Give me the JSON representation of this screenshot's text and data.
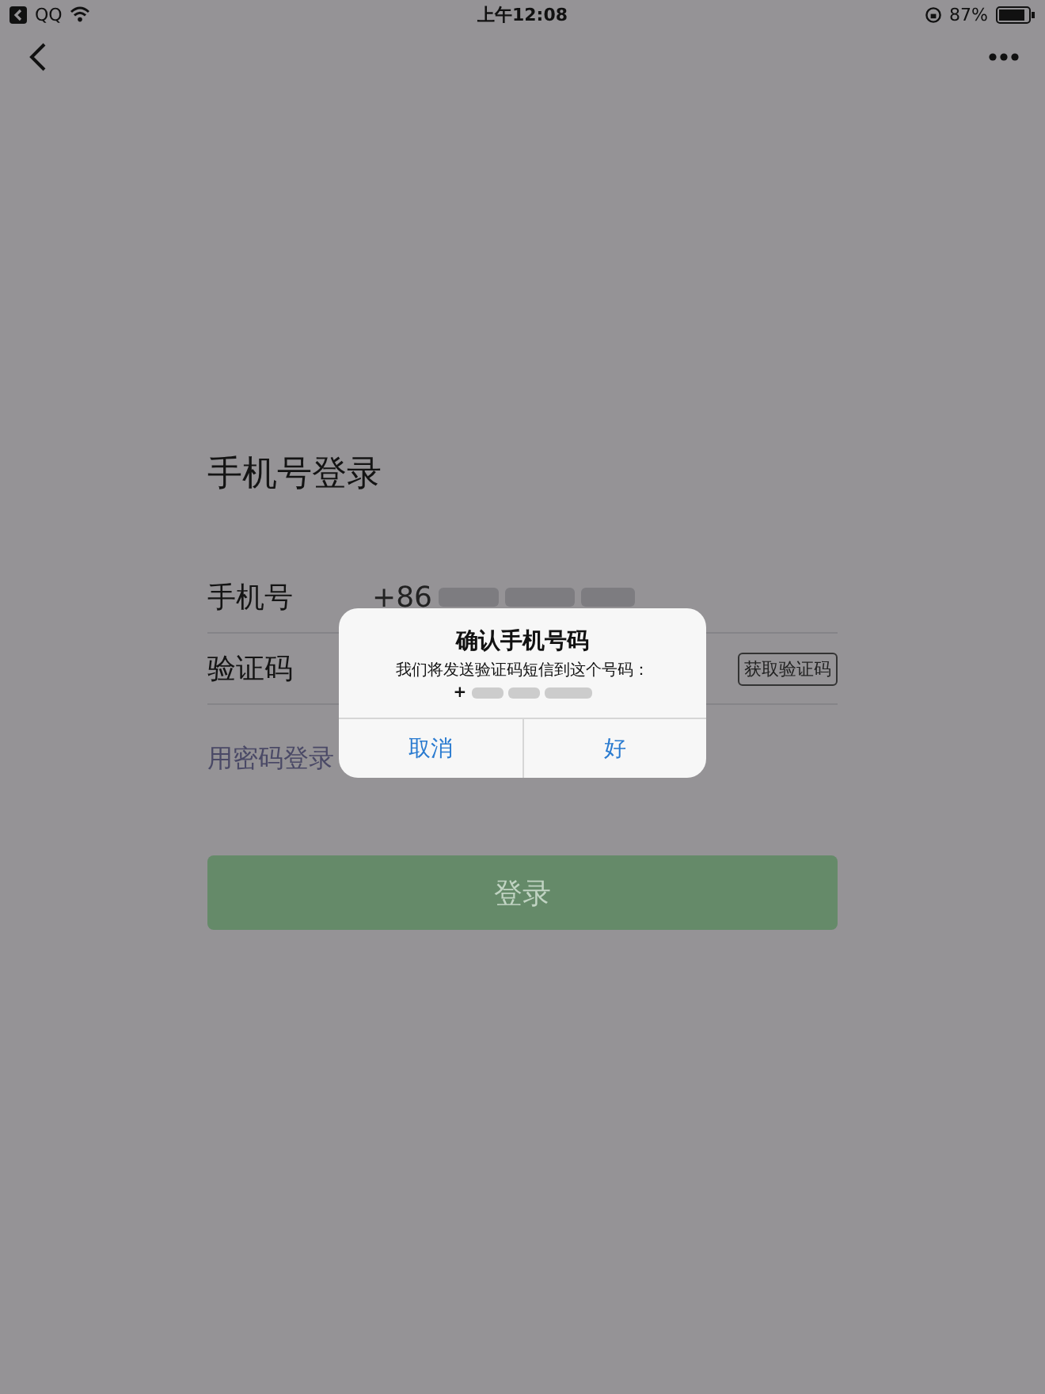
{
  "status_bar": {
    "back_app": "QQ",
    "time": "上午12:08",
    "battery": "87%"
  },
  "login": {
    "title": "手机号登录",
    "fields": [
      {
        "kind": "phone",
        "label": "手机号",
        "value": "+86"
      },
      {
        "kind": "code",
        "label": "验证码",
        "button": "获取验证码"
      }
    ],
    "alt_link": "用密码登录",
    "submit": {
      "label": "登录",
      "disabled": true
    }
  },
  "dialog": {
    "title": "确认手机号码",
    "message": "我们将发送验证码短信到这个号码：",
    "number": "+",
    "buttons": [
      "取消",
      "好"
    ]
  }
}
